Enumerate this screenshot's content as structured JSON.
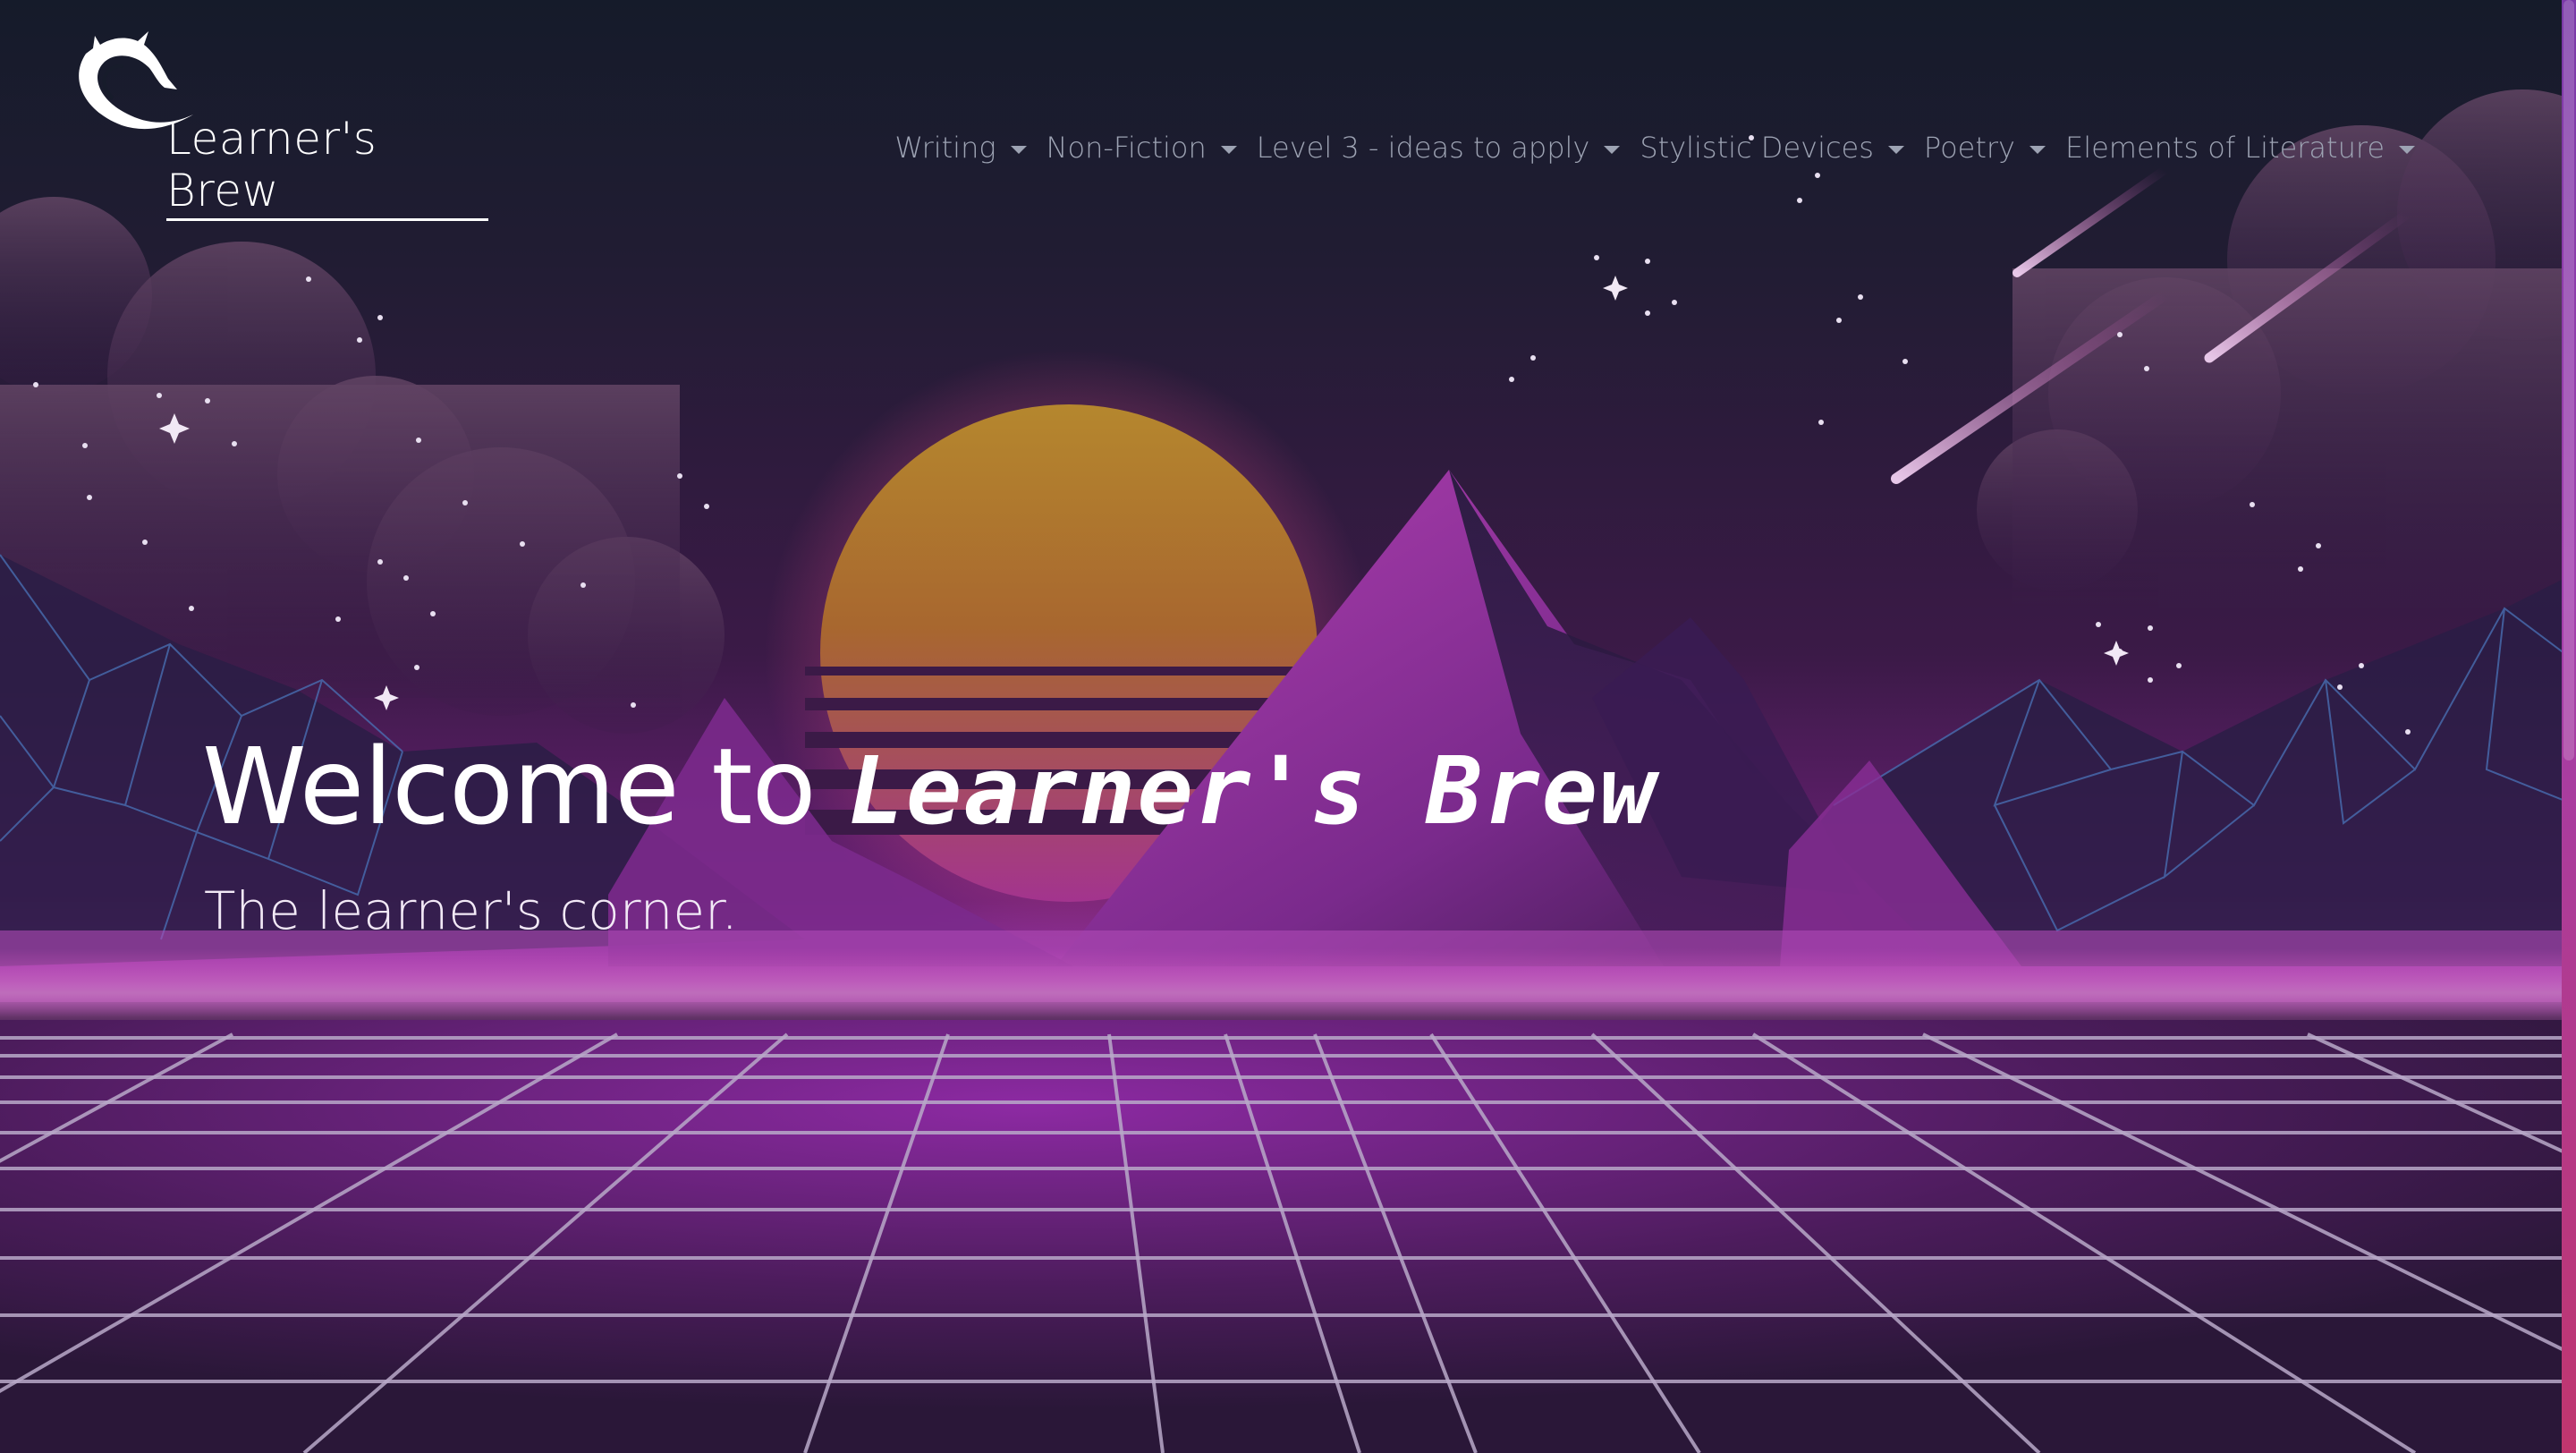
{
  "brand": {
    "name": "Learner's Brew",
    "logo_icon": "dragon-icon"
  },
  "nav": {
    "items": [
      {
        "label": "Writing"
      },
      {
        "label": "Non-Fiction"
      },
      {
        "label": "Level 3 - ideas to apply"
      },
      {
        "label": "Stylistic Devices"
      },
      {
        "label": "Poetry"
      },
      {
        "label": "Elements of Literature"
      }
    ]
  },
  "hero": {
    "title_prefix": "Welcome to ",
    "title_brand": "Learner's Brew",
    "subtitle": "The learner's corner."
  },
  "colors": {
    "sky_top": "#171c2b",
    "sky_mid": "#3a1a45",
    "horizon": "#a23ab0",
    "sun_top": "#c9952a",
    "sun_bottom": "#a03a95",
    "grid_line": "#b9a9c9",
    "nav_text": "#9da3b3"
  }
}
